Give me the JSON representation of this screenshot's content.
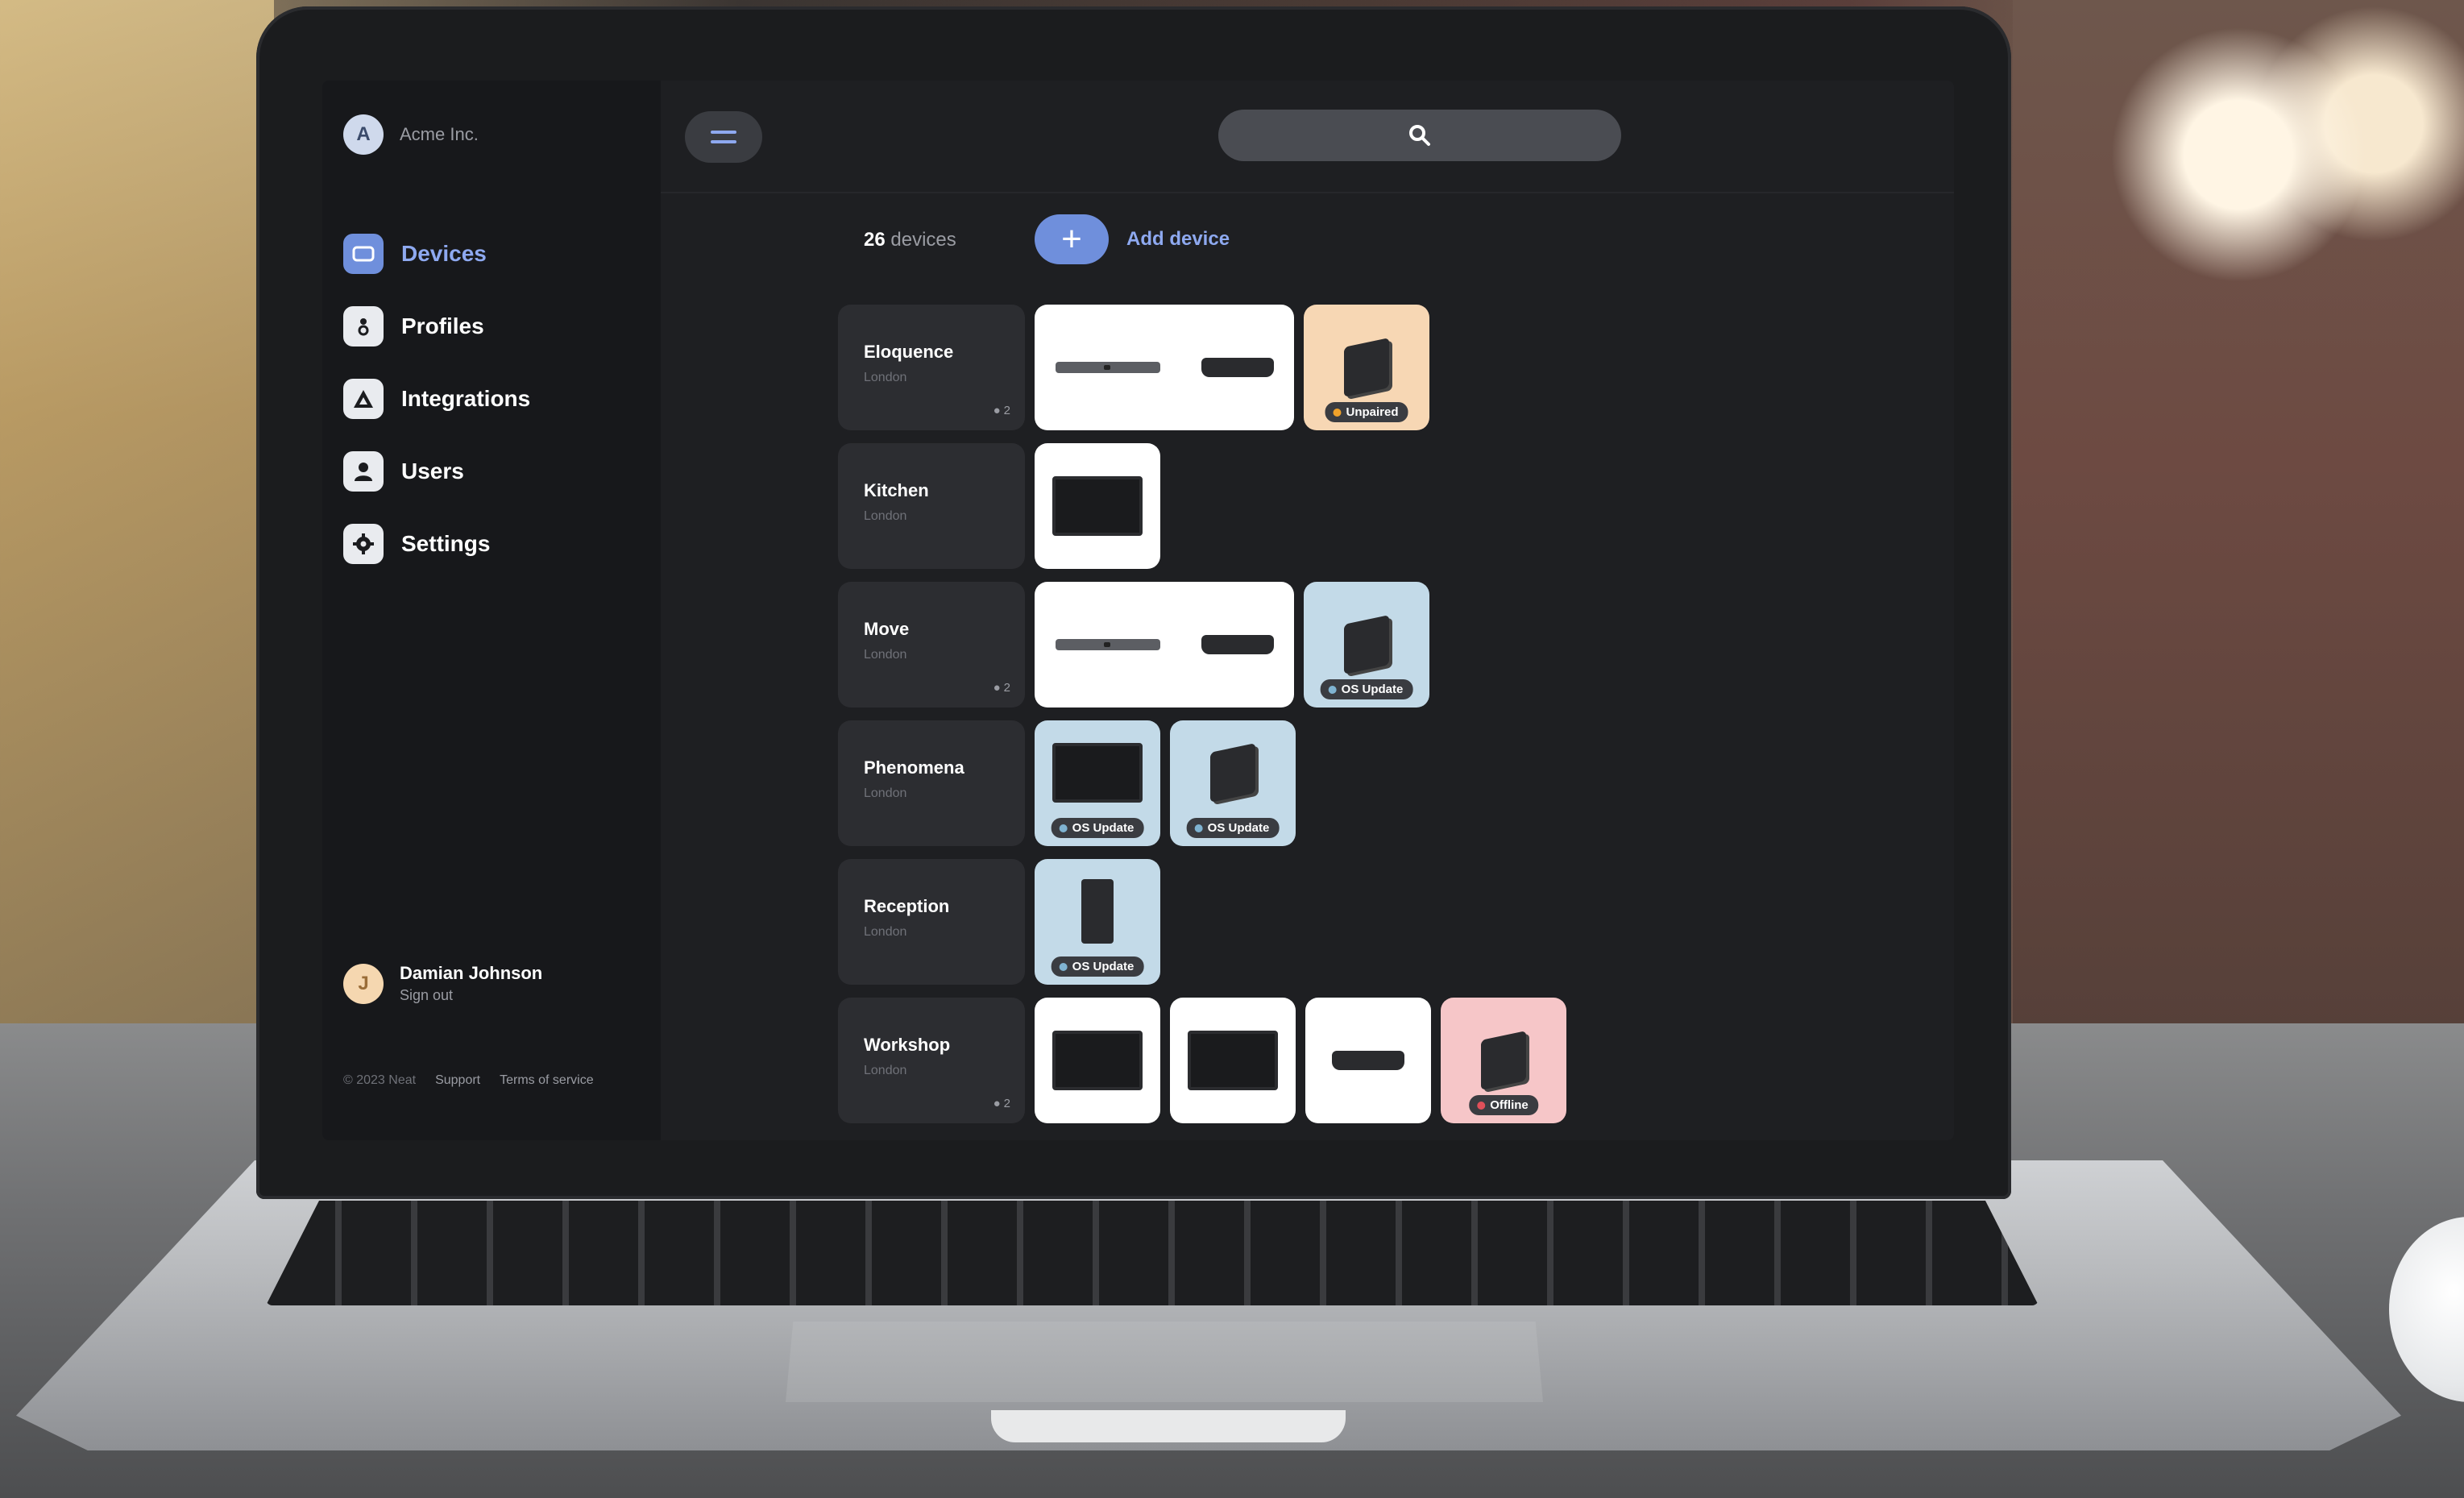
{
  "sidebar": {
    "brand": {
      "initial": "A",
      "name": "Acme Inc."
    },
    "nav": [
      {
        "label": "Devices",
        "icon": "devices-icon",
        "active": true
      },
      {
        "label": "Profiles",
        "icon": "profiles-icon",
        "active": false
      },
      {
        "label": "Integrations",
        "icon": "integrations-icon",
        "active": false
      },
      {
        "label": "Users",
        "icon": "users-icon",
        "active": false
      },
      {
        "label": "Settings",
        "icon": "gear-icon",
        "active": false
      }
    ],
    "user": {
      "initial": "J",
      "name": "Damian Johnson",
      "signout": "Sign out"
    },
    "footer": {
      "copyright": "© 2023 Neat",
      "support": "Support",
      "terms": "Terms of service"
    }
  },
  "topbar": {
    "search_placeholder": ""
  },
  "content": {
    "count_number": "26",
    "count_label": "devices",
    "add_label": "Add device",
    "add_symbol": "+"
  },
  "rooms": [
    {
      "name": "Eloquence",
      "location": "London",
      "people": "2"
    },
    {
      "name": "Kitchen",
      "location": "London",
      "people": ""
    },
    {
      "name": "Move",
      "location": "London",
      "people": "2"
    },
    {
      "name": "Phenomena",
      "location": "London",
      "people": ""
    },
    {
      "name": "Reception",
      "location": "London",
      "people": ""
    },
    {
      "name": "Workshop",
      "location": "London",
      "people": "2"
    }
  ],
  "badges": {
    "unpaired": "Unpaired",
    "os_update": "OS Update",
    "offline": "Offline"
  },
  "colors": {
    "accent": "#6f8fdc",
    "accent_text": "#8ea9f0",
    "unpaired_dot": "#f0a22a",
    "os_update_dot": "#7fb3d1",
    "offline_dot": "#e0505a"
  }
}
